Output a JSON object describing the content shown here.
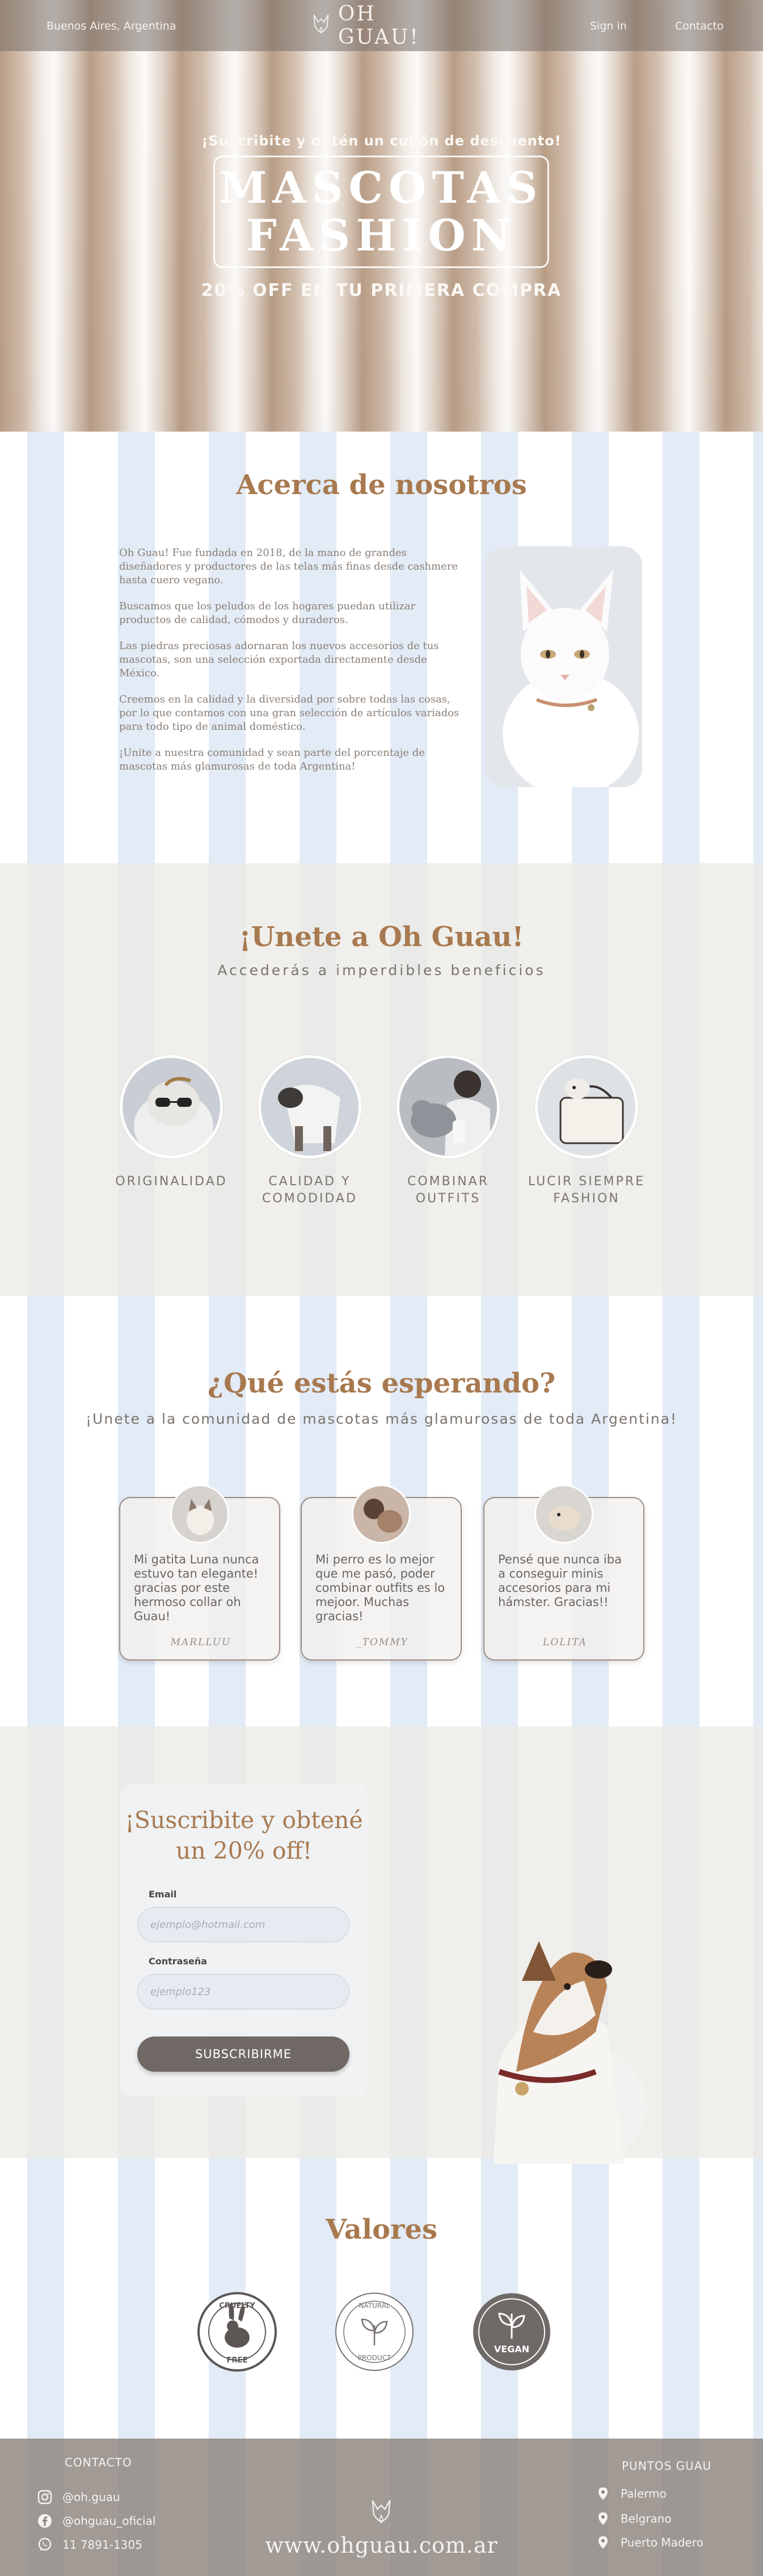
{
  "nav": {
    "location": "Buenos Aires, Argentina",
    "brand": "OH GUAU!",
    "signin": "Sign in",
    "contact": "Contacto"
  },
  "hero": {
    "kicker": "¡Suscribite y obtén un cupón de descuento!",
    "title_line1": "MASCOTAS",
    "title_line2": "FASHION",
    "subtitle": "20% OFF EN TU PRIMERA COMPRA"
  },
  "about": {
    "title": "Acerca de nosotros",
    "paragraphs": [
      "Oh Guau! Fue fundada en 2018, de la mano de grandes diseñadores y productores de las telas más finas desde cashmere hasta cuero vegano.",
      "Buscamos que los peludos de los hogares puedan utilizar productos de calidad, cómodos y duraderos.",
      "Las piedras preciosas adornaran los nuevos accesorios de tus mascotas, son una selección exportada directamente desde México.",
      "Creemos en la calidad y la diversidad por sobre todas las cosas, por lo que contamos con una gran selección de artículos variados para todo tipo de animal doméstico.",
      "¡Unite a nuestra comunidad y sean parte del  porcentaje de mascotas más glamurosas de toda Argentina!"
    ]
  },
  "join": {
    "title": "¡Unete a Oh Guau!",
    "subtitle": "Accederás a imperdibles beneficios",
    "benefits": [
      {
        "line1": "ORIGINALIDAD",
        "line2": ""
      },
      {
        "line1": "CALIDAD Y",
        "line2": "COMODIDAD"
      },
      {
        "line1": "COMBINAR",
        "line2": "OUTFITS"
      },
      {
        "line1": "LUCIR SIEMPRE",
        "line2": "FASHION"
      }
    ]
  },
  "testimonials": {
    "title": "¿Qué estás esperando?",
    "subtitle": "¡Unete a la comunidad de mascotas más glamurosas de toda Argentina!",
    "items": [
      {
        "quote": "Mi gatita Luna nunca estuvo tan elegante! gracias por este hermoso collar oh Guau!",
        "author": "MARLLUU"
      },
      {
        "quote": "Mi perro es lo mejor que me pasó, poder combinar outfits es lo mejoor. Muchas gracias!",
        "author": "_TOMMY"
      },
      {
        "quote": "Pensé que nunca iba a conseguir minis accesorios para mi hámster. Gracias!!",
        "author": "LOLITA"
      }
    ]
  },
  "subscribe": {
    "title": "¡Suscribite y obtené un 20% off!",
    "email_label": "Email",
    "email_placeholder": "ejemplo@hotmail.com",
    "password_label": "Contraseña",
    "password_placeholder": "ejemplo123",
    "button": "SUBSCRIBIRME"
  },
  "values": {
    "title": "Valores",
    "badges": [
      {
        "icon": "cruelty-free-icon",
        "top": "CRUELTY",
        "bottom": "FREE"
      },
      {
        "icon": "natural-product-icon",
        "top": "NATURAL",
        "bottom": "PRODUCT"
      },
      {
        "icon": "vegan-icon",
        "text": "VEGAN"
      }
    ]
  },
  "footer": {
    "contact_heading": "CONTACTO",
    "instagram": "@oh.guau",
    "facebook": "@ohguau_oficial",
    "whatsapp": "11 7891-1305",
    "points_heading": "PUNTOS GUAU",
    "points": [
      "Palermo",
      "Belgrano",
      "Puerto Madero"
    ],
    "url": "www.ohguau.com.ar"
  },
  "colors": {
    "accent": "#a8794f",
    "text": "#6f6a66",
    "stripe_blue": "#e2ebf6",
    "button": "#6f6865"
  }
}
